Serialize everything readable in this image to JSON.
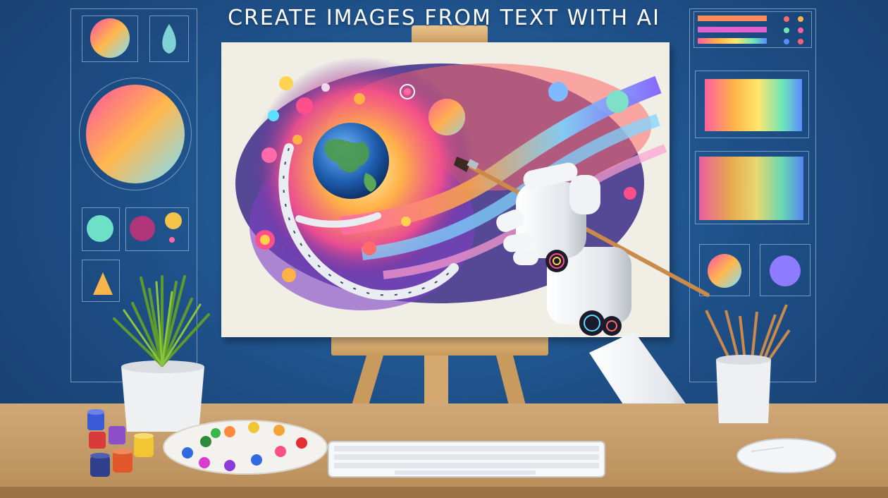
{
  "header": {
    "title": "CREATE IMAGES FROM TEXT WITH AI"
  },
  "palette": {
    "background": "#1f4f86",
    "accent_wire": "#bed7f0",
    "desk": "#c9a170"
  },
  "icons": {
    "robot_hand": "robot-hand-icon",
    "paintbrush": "paintbrush-icon",
    "earth": "earth-icon",
    "easel": "easel-icon",
    "plant": "plant-icon",
    "keyboard": "keyboard-icon",
    "mouse": "mouse-icon",
    "paint_palette": "paint-palette-icon",
    "brush_cup": "brush-cup-icon",
    "paint_jars": "paint-jars-icon"
  }
}
